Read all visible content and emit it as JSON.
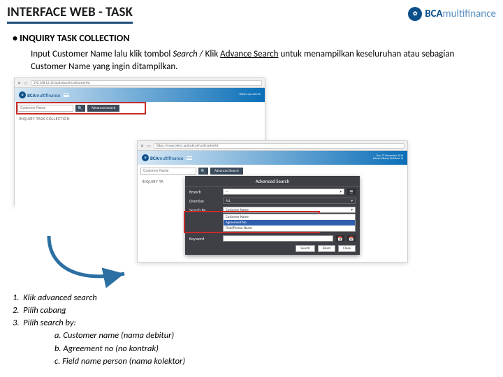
{
  "header": {
    "title": "INTERFACE WEB - TASK",
    "logo_brand": "BCA",
    "logo_sub": "multifinance"
  },
  "section_title": "INQUIRY TASK COLLECTION",
  "desc": {
    "p1a": "Input Customer Name lalu klik tombol ",
    "p1b": "Search / ",
    "p1c": "Klik ",
    "p1d": "Advance Search",
    "p1e": " untuk menampilkan keseluruhan atau sebagian Customer Name yang ingin ditampilkan."
  },
  "shot1": {
    "url": "192.168.12.12/apitaskcoll/collmasterlist",
    "brand": "BCA",
    "brand_sub": "multifinance",
    "search_placeholder": "Customer Name",
    "adv_label": "Advanced search",
    "page_title": "INQUIRY TASK COLLECTION",
    "user_line1": "What's up Lady/Sir",
    "user_line2": ""
  },
  "shot2": {
    "url": "https://easycollect.apitaskcoll/collmasterlist",
    "brand": "BCA",
    "brand_sub": "multifinance",
    "search_placeholder": "Customer Name",
    "adv_label": "Advanced Search",
    "page_title": "INQUIRY TA",
    "user_line1": "Tue, 17 December 2019",
    "user_line2": "Krisna Subway (Kolektor 1)",
    "modal": {
      "title": "Advanced Search",
      "labels": {
        "branch": "Branch",
        "ovd": "Overdue",
        "searchby": "Search By",
        "keyword": "Keyword"
      },
      "branch_value": "--",
      "ovd_value": "ALL",
      "searchby_value": "Customer Name",
      "keyword_value": "",
      "options": [
        "Customer Name",
        "Agreement No",
        "Field Person Name"
      ],
      "btn_search": "Search",
      "btn_reset": "Reset",
      "btn_close": "Close"
    }
  },
  "steps": {
    "s1": "Klik advanced search",
    "s2": "Pilih cabang",
    "s3": "Pilih search by:",
    "s3a": "a. Customer name (nama debitur)",
    "s3b": "b. Agreement no  (no kontrak)",
    "s3c": "c. Field name person (nama kolektor)"
  }
}
